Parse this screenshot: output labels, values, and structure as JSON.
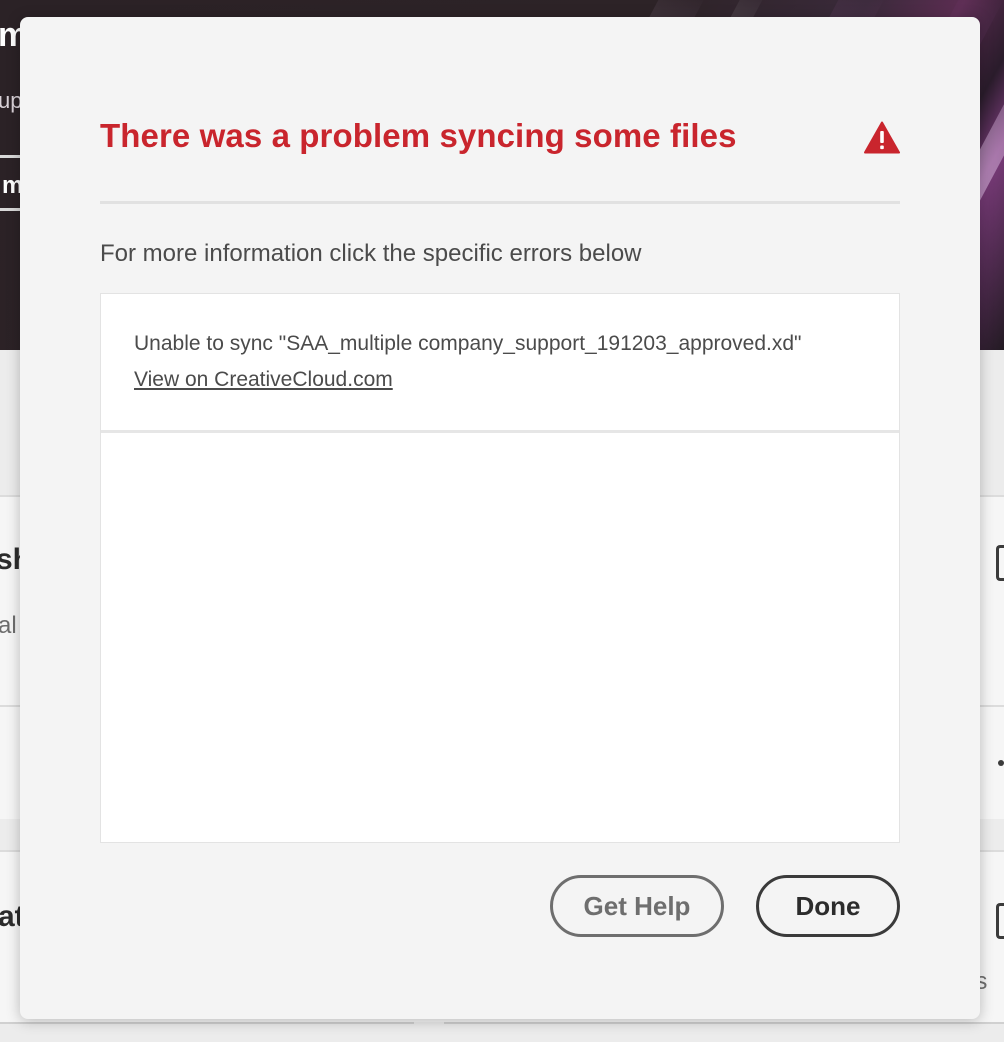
{
  "background": {
    "hero_title_fragment": "m",
    "hero_subtitle_fragment": "up",
    "hero_button_fragment": "m",
    "card1_title_fragment": "sh",
    "card1_text_fragment": "al g",
    "card2_title_fragment": "at",
    "card3_text_fragment": "es"
  },
  "dialog": {
    "title": "There was a problem syncing some files",
    "alert_icon": "alert-triangle-icon",
    "title_color": "#c9252d",
    "description": "For more information click the specific errors below",
    "errors": [
      {
        "message": "Unable to sync \"SAA_multiple company_support_191203_approved.xd\"",
        "link_label": "View on CreativeCloud.com"
      }
    ],
    "buttons": {
      "get_help": "Get Help",
      "done": "Done"
    }
  }
}
